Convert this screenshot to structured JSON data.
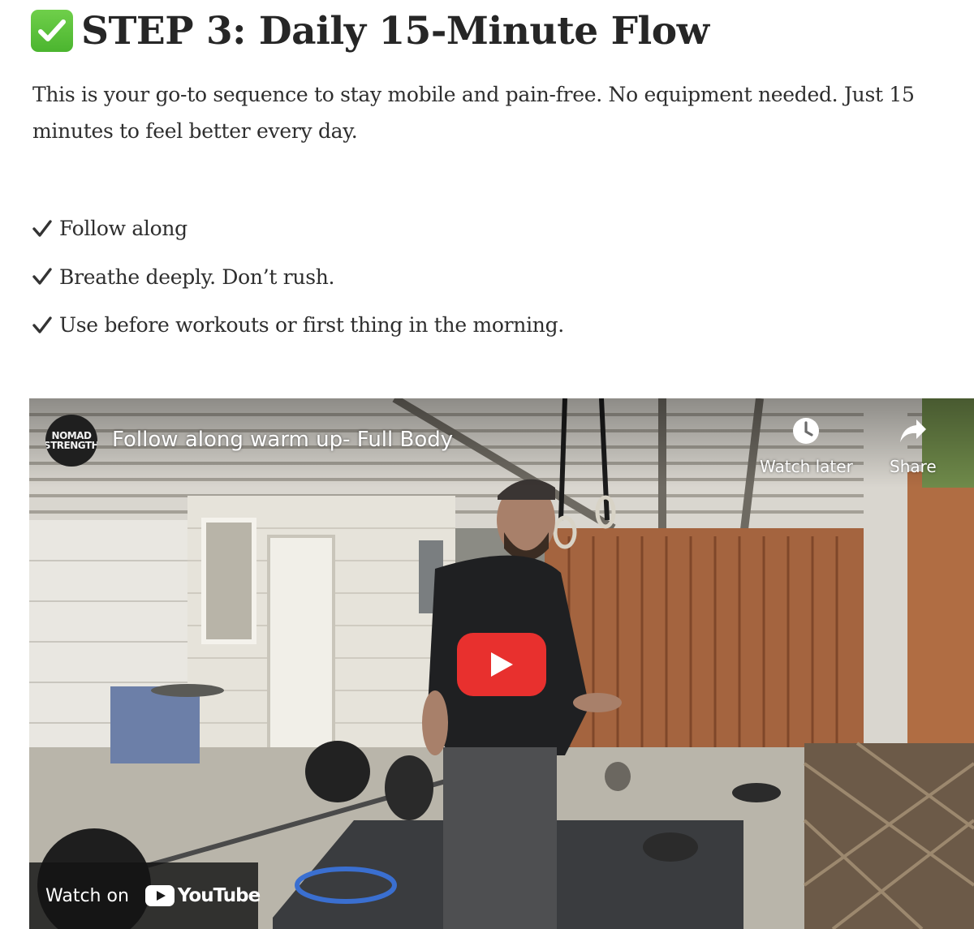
{
  "heading": {
    "icon": "check-mark-button-icon",
    "text": "STEP 3: Daily 15-Minute Flow"
  },
  "intro": "This is your go-to sequence to stay mobile and pain-free. No equipment needed. Just 15 minutes to feel better every day.",
  "checklist": [
    "Follow along",
    "Breathe deeply. Don’t rush.",
    "Use before workouts or first thing in the morning."
  ],
  "video": {
    "channel_avatar_text": "NOMAD STRENGTH",
    "title": "Follow along warm up- Full Body",
    "watch_later_label": "Watch later",
    "share_label": "Share",
    "watch_on_label": "Watch on",
    "youtube_label": "YouTube"
  },
  "colors": {
    "check_green": "#4bb52f",
    "play_red": "#e8302e",
    "text": "#2e2e2e"
  }
}
